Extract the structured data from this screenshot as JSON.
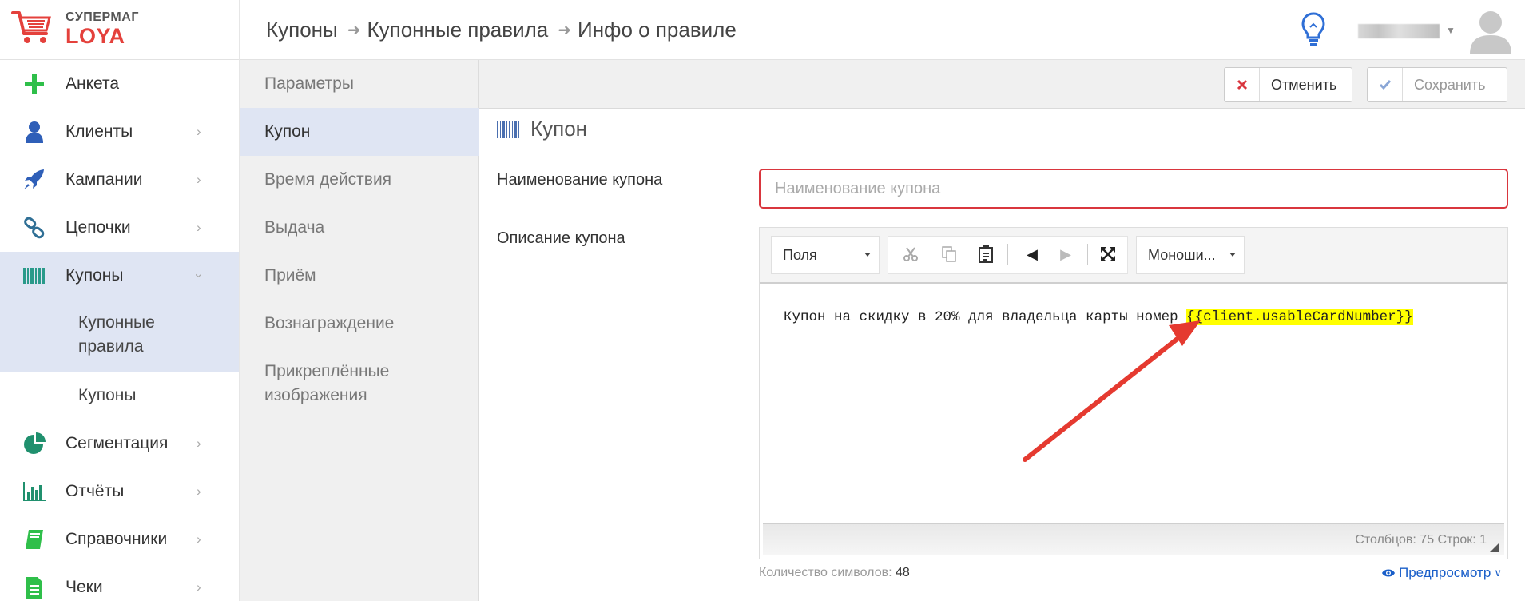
{
  "app": {
    "logo_top": "СУПЕРМАГ",
    "logo_bottom": "LOYA"
  },
  "breadcrumb": [
    "Купоны",
    "Купонные правила",
    "Инфо о правиле"
  ],
  "sidebar": {
    "items": [
      {
        "label": "Анкета",
        "icon": "plus-icon",
        "color": "#2fbf4a"
      },
      {
        "label": "Клиенты",
        "icon": "user-icon",
        "color": "#2f5fb8"
      },
      {
        "label": "Кампании",
        "icon": "rocket-icon",
        "color": "#2f5fb8"
      },
      {
        "label": "Цепочки",
        "icon": "link-icon",
        "color": "#2f6f95"
      },
      {
        "label": "Купоны",
        "icon": "barcode-icon",
        "color": "#2a9a8a"
      },
      {
        "label": "Сегментация",
        "icon": "pie-chart-icon",
        "color": "#20906e"
      },
      {
        "label": "Отчёты",
        "icon": "bar-chart-icon",
        "color": "#20906e"
      },
      {
        "label": "Справочники",
        "icon": "book-icon",
        "color": "#2fbf4a"
      },
      {
        "label": "Чеки",
        "icon": "receipt-icon",
        "color": "#2fbf4a"
      }
    ],
    "sub_items": [
      "Купонные правила",
      "Купоны"
    ]
  },
  "menu2": {
    "items": [
      "Параметры",
      "Купон",
      "Время действия",
      "Выдача",
      "Приём",
      "Вознаграждение",
      "Прикреплённые изображения"
    ]
  },
  "toolbar": {
    "cancel_label": "Отменить",
    "save_label": "Сохранить"
  },
  "section": {
    "title": "Купон"
  },
  "form": {
    "name_label": "Наименование купона",
    "name_placeholder": "Наименование купона",
    "name_value": "",
    "desc_label": "Описание купона"
  },
  "editor": {
    "fields_select": "Поля",
    "font_select": "Моноши...",
    "text_plain": "Купон на скидку в 20% для владельца карты номер ",
    "text_highlight": "{{client.usableCardNumber}}",
    "status": "Столбцов: 75 Строк: 1"
  },
  "footer": {
    "char_count_label": "Количество символов:",
    "char_count_value": "48",
    "preview_label": "Предпросмотр"
  },
  "colors": {
    "accent": "#1a5fc9",
    "active_bg": "#dfe5f3",
    "error_border": "#d9363e",
    "logo_red": "#e4413c",
    "highlight": "#ffff00",
    "annotation_arrow": "#e53a30"
  }
}
